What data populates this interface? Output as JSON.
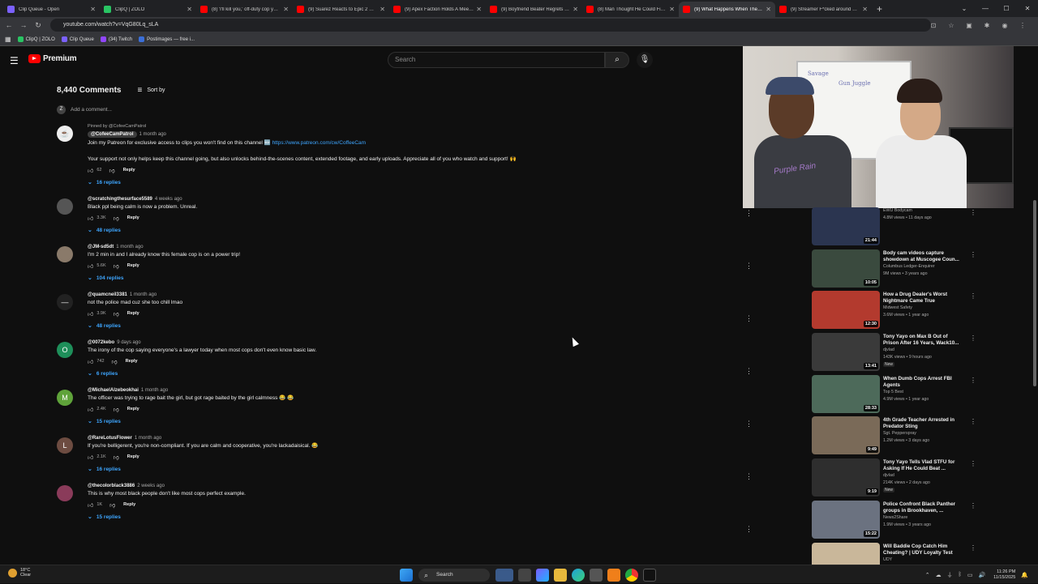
{
  "browser": {
    "tabs": [
      {
        "title": "Clip Queue - Open",
        "color": "#7b61ff"
      },
      {
        "title": "ClipQ | ZOLO",
        "color": "#29c463"
      },
      {
        "title": "(8) 'I'll kill you,' off-duty cop yel...",
        "color": "#ff0000"
      },
      {
        "title": "(9) Suarez Reacts to Epic 2 Gam...",
        "color": "#ff0000"
      },
      {
        "title": "(9) Apex Faction Holds A Meetin...",
        "color": "#ff0000"
      },
      {
        "title": "(9) Boyfriend Beater Regrets Try...",
        "color": "#ff0000"
      },
      {
        "title": "(8) Man Thought He Could Figh...",
        "color": "#ff0000"
      },
      {
        "title": "(9) What Happens When The Fi...",
        "color": "#ff0000"
      },
      {
        "title": "(9) Streamer F*cked around and...",
        "color": "#ff0000"
      }
    ],
    "active_tab": 7,
    "url": "youtube.com/watch?v=VqG80Lq_sLA",
    "bookmarks": [
      {
        "label": "ClipQ | ZOLO",
        "color": "#29c463"
      },
      {
        "label": "Clip Queue",
        "color": "#7b61ff"
      },
      {
        "label": "(34) Twitch",
        "color": "#9146ff"
      },
      {
        "label": "Postimages — free i...",
        "color": "#3b6fd8"
      }
    ]
  },
  "youtube": {
    "logo_text": "Premium",
    "search_placeholder": "Search"
  },
  "camera": {
    "board_notes": [
      "Savage",
      "Gun Juggle"
    ],
    "shirt_text": "Purple Rain"
  },
  "comments": {
    "count_label": "8,440 Comments",
    "sort_label": "Sort by",
    "add_placeholder": "Add a comment...",
    "items": [
      {
        "pinned_by": "Pinned by @CofeeCamPatrol",
        "handle": "@CofeeCamPatrol",
        "time": "1 month ago",
        "text": "Join my Patreon for exclusive access to clips you won't find on this channel 🆕",
        "link": "https://www.patreon.com/cw/CoffeeCam",
        "text2": "Your support not only helps keep this channel going, but also unlocks behind-the-scenes content, extended footage, and early uploads. Appreciate all of you who watch and support! 🙌",
        "likes": "62",
        "replies": "16 replies",
        "avatar_color": "#eeeeee",
        "avatar_letter": "☕"
      },
      {
        "handle": "@scratchingthesurface5589",
        "time": "4 weeks ago",
        "text": "Black ppl being calm is now a problem.  Unreal.",
        "likes": "3.3K",
        "replies": "48 replies",
        "avatar_color": "#555555",
        "avatar_letter": ""
      },
      {
        "handle": "@JM-sd5dt",
        "time": "1 month ago",
        "text": "I'm 2 min in and I already know this female cop is on a power trip!",
        "likes": "5.6K",
        "replies": "104 replies",
        "avatar_color": "#8a7a6a",
        "avatar_letter": ""
      },
      {
        "handle": "@quamcneil3381",
        "time": "1 month ago",
        "text": "not the police mad cuz she too chill lmao",
        "likes": "3.9K",
        "replies": "48 replies",
        "avatar_color": "#222222",
        "avatar_letter": "—"
      },
      {
        "handle": "@0072kebo",
        "time": "9 days ago",
        "text": "The irony of the cop saying everyone's a lawyer today when most cops don't even know basic law.",
        "likes": "742",
        "replies": "6 replies",
        "avatar_color": "#1e8f5a",
        "avatar_letter": "O"
      },
      {
        "handle": "@MichaelAlzebeokhai",
        "time": "1 month ago",
        "text": "The officer was trying to rage bait the girl, but got rage baited by the girl calmness 😂 😂",
        "likes": "2.4K",
        "replies": "15 replies",
        "avatar_color": "#5fa33a",
        "avatar_letter": "M"
      },
      {
        "handle": "@RareLotusFlower",
        "time": "1 month ago",
        "text": "If you're belligerent, you're non-compliant. If you are calm and cooperative, you're lackadaisical. 😂",
        "likes": "2.1K",
        "replies": "16 replies",
        "avatar_color": "#6d4c41",
        "avatar_letter": "L"
      },
      {
        "handle": "@thecolorblack3886",
        "time": "2 weeks ago",
        "text": "This is why most black people don't like most cops perfect example.",
        "likes": "1K",
        "replies": "15 replies",
        "avatar_color": "#8a3b5a",
        "avatar_letter": ""
      }
    ]
  },
  "recommendations": [
    {
      "title": "",
      "channel": "EWU Bodycam",
      "views": "4.8M views • 11 days ago",
      "duration": "21:44",
      "thumb": "#2b3550",
      "new": ""
    },
    {
      "title": "Body cam videos capture showdown at Muscogee Coun...",
      "channel": "Columbus Ledger-Enquirer",
      "views": "9M views • 3 years ago",
      "duration": "10:05",
      "thumb": "#3a4a3e",
      "new": ""
    },
    {
      "title": "How a Drug Dealer's Worst Nightmare Came True",
      "channel": "Midwest Safety",
      "views": "3.6M views • 1 year ago",
      "duration": "12:30",
      "thumb": "#b33a2e",
      "new": ""
    },
    {
      "title": "Tony Yayo on Max B Out of Prison After 16 Years, Wack10...",
      "channel": "djvlad",
      "views": "143K views • 9 hours ago",
      "duration": "13:41",
      "thumb": "#3a3a3a",
      "new": "New"
    },
    {
      "title": "When Dumb Cops Arrest FBI Agents",
      "channel": "Top 5 Best",
      "views": "4.9M views • 1 year ago",
      "duration": "28:33",
      "thumb": "#4d6a5a",
      "new": ""
    },
    {
      "title": "4th Grade Teacher Arrested in Predator Sting",
      "channel": "Sgt. Pepperspray",
      "views": "1.2M views • 3 days ago",
      "duration": "9:49",
      "thumb": "#7a6a58",
      "new": ""
    },
    {
      "title": "Tony Yayo Tells Vlad STFU for Asking If He Could Beat ...",
      "channel": "djvlad",
      "views": "214K views • 2 days ago",
      "duration": "9:19",
      "thumb": "#2e2e2e",
      "new": "New"
    },
    {
      "title": "Police Confront Black Panther groups in Brookhaven, ...",
      "channel": "News2Share",
      "views": "1.9M views • 3 years ago",
      "duration": "15:22",
      "thumb": "#6b7280",
      "new": ""
    },
    {
      "title": "Will Baddie Cop Catch Him Cheating? | UDY Loyalty Test",
      "channel": "UDY",
      "views": "1.9M views • 10 days ago",
      "duration": "41:00",
      "thumb": "#c9b79a",
      "new": ""
    }
  ],
  "taskbar": {
    "weather_temp": "18°C",
    "weather_cond": "Clear",
    "search_label": "Search",
    "time": "11:26 PM",
    "date": "11/15/2025"
  }
}
